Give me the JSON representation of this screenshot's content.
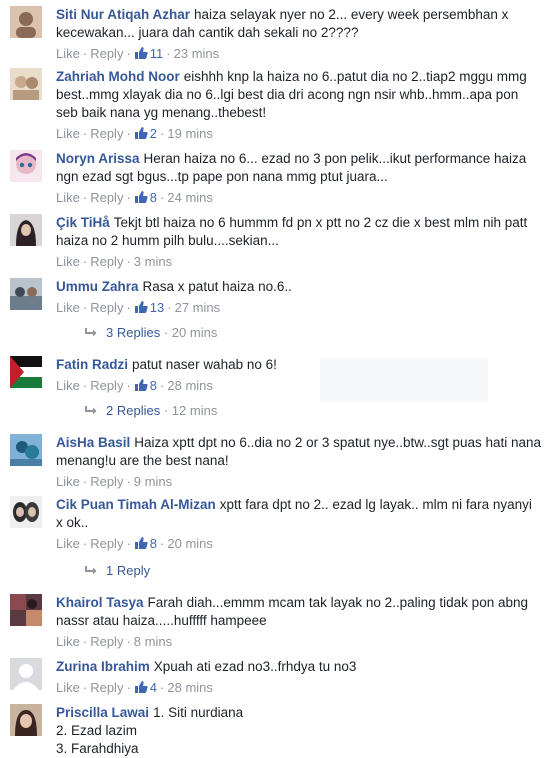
{
  "comments": [
    {
      "name": "Siti Nur Atiqah Azhar",
      "text": "haiza selayak nyer no 2... every week persembhan x kecewakan... juara dah cantik dah sekali no 2????",
      "like": "Like",
      "reply": "Reply",
      "likes": "11",
      "time": "23 mins",
      "avatar_color": "#8a6a57"
    },
    {
      "name": "Zahriah Mohd Noor",
      "text": "eishhh knp la haiza no 6..patut dia no 2..tiap2 mggu mmg best..mmg xlayak dia no 6..lgi best dia dri acong ngn nsir whb..hmm..apa pon seb baik nana yg menang..thebest!",
      "like": "Like",
      "reply": "Reply",
      "likes": "2",
      "time": "19 mins",
      "avatar_color": "#c7a88a"
    },
    {
      "name": "Noryn Arissa",
      "text": "Heran haiza no 6... ezad no 3 pon pelik...ikut performance haiza ngn ezad sgt bgus...tp pape pon nana mmg ptut juara...",
      "like": "Like",
      "reply": "Reply",
      "likes": "8",
      "time": "24 mins",
      "avatar_color": "#e8b7c6"
    },
    {
      "name": "Çik TiHå",
      "text": "Tekjt btl haiza no 6 hummm fd pn x ptt no 2 cz die x best mlm nih patt haiza no 2 humm pilh bulu....sekian...",
      "like": "Like",
      "reply": "Reply",
      "likes": "",
      "time": "3 mins",
      "avatar_color": "#2b2226"
    },
    {
      "name": "Ummu Zahra",
      "text": "Rasa x patut haiza no.6..",
      "like": "Like",
      "reply": "Reply",
      "likes": "13",
      "time": "27 mins",
      "avatar_color": "#6e7d8c"
    },
    {
      "name": "Fatin Radzi",
      "text": "patut naser wahab no 6!",
      "like": "Like",
      "reply": "Reply",
      "likes": "8",
      "time": "28 mins",
      "avatar_color": "#3a3a3a"
    },
    {
      "name": "AisHa Basil",
      "text": "Haiza xptt dpt no 6..dia no 2 or 3 spatut nye..btw..sgt puas hati nana menang!u are the best nana!",
      "like": "Like",
      "reply": "Reply",
      "likes": "",
      "time": "9 mins",
      "avatar_color": "#4a7fa8"
    },
    {
      "name": "Cik Puan Timah Al-Mizan",
      "text": "xptt fara dpt no 2.. ezad lg layak.. mlm ni fara nyanyi x ok..",
      "like": "Like",
      "reply": "Reply",
      "likes": "8",
      "time": "20 mins",
      "avatar_color": "#cfcfcf"
    },
    {
      "name": "Khairol Tasya",
      "text": "Farah diah...emmm mcam tak layak no 2..paling tidak pon abng nassr atau haiza.....hufffff hampeee",
      "like": "Like",
      "reply": "Reply",
      "likes": "",
      "time": "8 mins",
      "avatar_color": "#8b4a52"
    },
    {
      "name": "Zurina Ibrahim",
      "text": "Xpuah ati ezad no3..frhdya tu no3",
      "like": "Like",
      "reply": "Reply",
      "likes": "4",
      "time": "28 mins",
      "avatar_color": "#d8dade"
    },
    {
      "name": "Priscilla Lawai",
      "text_lines": [
        "1. Siti nurdiana",
        "2. Ezad lazim",
        "3. Farahdhiya"
      ],
      "avatar_color": "#6b4b3e"
    }
  ],
  "reply_threads": [
    {
      "label": "3 Replies",
      "time": "20 mins"
    },
    {
      "label": "2 Replies",
      "time": "12 mins"
    },
    {
      "label": "1 Reply",
      "time": ""
    }
  ]
}
